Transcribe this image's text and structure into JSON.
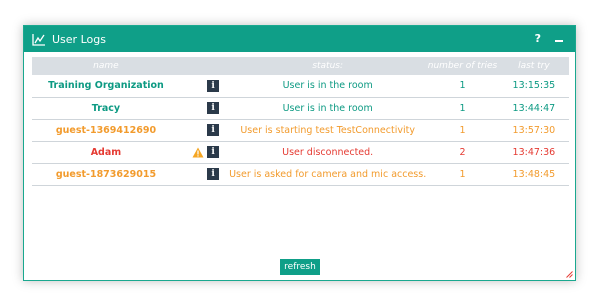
{
  "window": {
    "title": "User Logs",
    "help_label": "?"
  },
  "columns": [
    "name",
    "status:",
    "number of tries",
    "last try"
  ],
  "rows": [
    {
      "name": "Training Organization",
      "status": "User is in the room",
      "tries": "1",
      "last_try": "13:15:35",
      "color": "teal",
      "warning": false
    },
    {
      "name": "Tracy",
      "status": "User is in the room",
      "tries": "1",
      "last_try": "13:44:47",
      "color": "teal",
      "warning": false
    },
    {
      "name": "guest-1369412690",
      "status": "User is starting test TestConnectivity",
      "tries": "1",
      "last_try": "13:57:30",
      "color": "orange",
      "warning": false
    },
    {
      "name": "Adam",
      "status": "User disconnected.",
      "tries": "2",
      "last_try": "13:47:36",
      "color": "red",
      "warning": true
    },
    {
      "name": "guest-1873629015",
      "status": "User is asked for camera and mic access.",
      "tries": "1",
      "last_try": "13:48:45",
      "color": "orange",
      "warning": false
    }
  ],
  "info_glyph": "i",
  "refresh_label": "refresh",
  "colors": {
    "teal": "#0d9a83",
    "orange": "#f29b2d",
    "red": "#e53a32",
    "header": "#0f9f88",
    "warning": "#f5a623"
  },
  "icons": {
    "title": "line-chart-icon",
    "info": "info-icon",
    "warning": "warning-icon",
    "minimize": "minimize-icon",
    "resize": "resize-handle-icon"
  }
}
